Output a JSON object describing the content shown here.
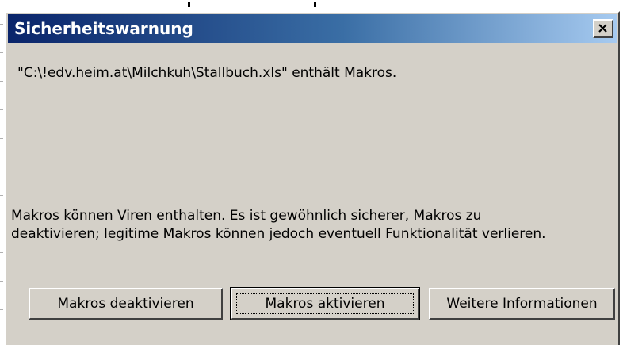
{
  "dialog": {
    "title": "Sicherheitswarnung",
    "close_label": "Close",
    "message_file": "\"C:\\!edv.heim.at\\Milchkuh\\Stallbuch.xls\" enthält Makros.",
    "message_warning_line1": "Makros können Viren enthalten. Es ist gewöhnlich sicherer, Makros zu",
    "message_warning_line2": "deaktivieren; legitime Makros können jedoch eventuell Funktionalität verlieren.",
    "buttons": {
      "deactivate": "Makros deaktivieren",
      "activate": "Makros aktivieren",
      "more_info": "Weitere Informationen"
    }
  },
  "colors": {
    "title_gradient_start": "#0a246a",
    "title_gradient_end": "#a6caf0",
    "dialog_face": "#d4d0c8"
  },
  "icons": {
    "close": "close-icon"
  }
}
